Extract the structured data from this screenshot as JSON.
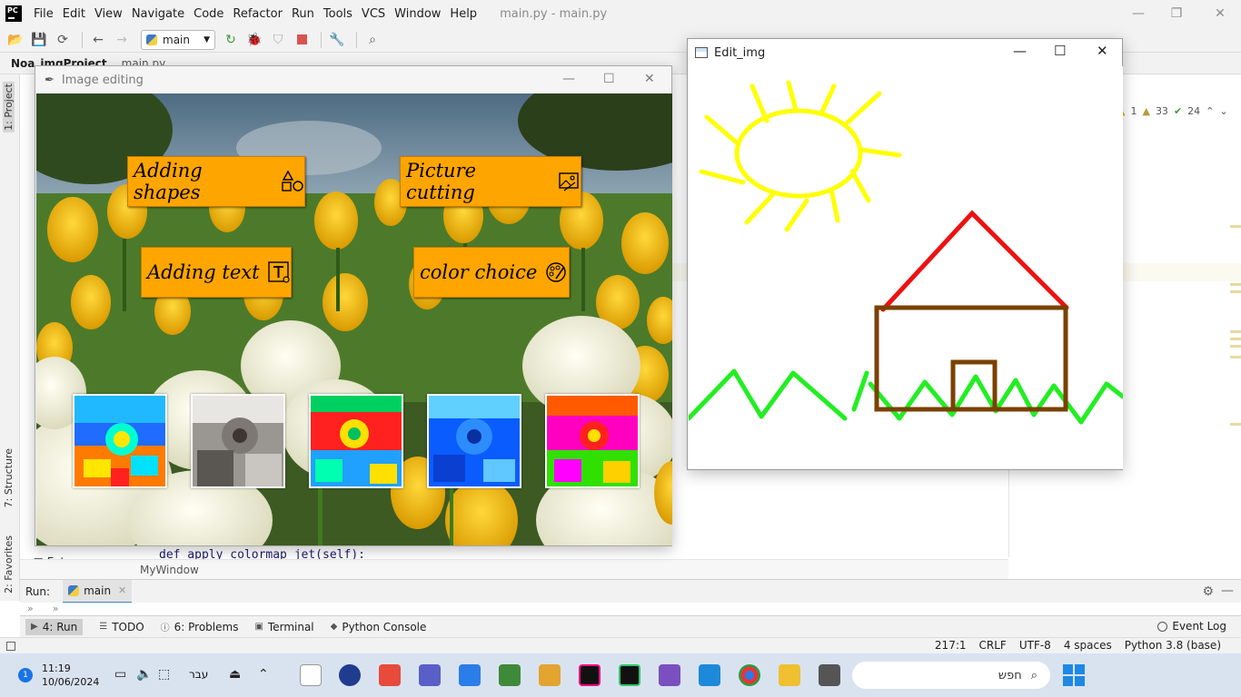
{
  "ide": {
    "menu": [
      "File",
      "Edit",
      "View",
      "Navigate",
      "Code",
      "Refactor",
      "Run",
      "Tools",
      "VCS",
      "Window",
      "Help"
    ],
    "title": "main.py - main.py",
    "run_config": "main",
    "project_crumb": "Noa_imgProject",
    "file_crumb": "main.py",
    "inspections": {
      "warnings_a": "1",
      "warnings_b": "33",
      "ok": "24"
    },
    "code_peek_line": "def apply_colormap_jet(self):",
    "tree_item": "Ext",
    "structure_crumb": "MyWindow",
    "side_tabs": {
      "project": "1: Project",
      "structure": "7: Structure",
      "favorites": "2: Favorites"
    }
  },
  "run_panel": {
    "label": "Run:",
    "tab": "main"
  },
  "tool_tabs": {
    "run": "4: Run",
    "todo": "TODO",
    "problems": "6: Problems",
    "terminal": "Terminal",
    "python_console": "Python Console",
    "event_log": "Event Log"
  },
  "status": {
    "position": "217:1",
    "line_sep": "CRLF",
    "encoding": "UTF-8",
    "indent": "4 spaces",
    "interpreter": "Python 3.8 (base)"
  },
  "image_editing": {
    "title": "Image editing",
    "buttons": {
      "adding_shapes": "Adding shapes",
      "picture_cutting": "Picture cutting",
      "adding_text": "Adding text",
      "color_choice": "color choice"
    },
    "button_color": "#ffa500"
  },
  "edit_img": {
    "title": "Edit_img",
    "colors": {
      "sun": "#ffff00",
      "roof": "#ee1111",
      "house": "#7b4100",
      "grass": "#22ee22"
    }
  },
  "taskbar": {
    "time": "11:19",
    "date": "10/06/2024",
    "lang": "עבר",
    "search_placeholder": "חפש",
    "notification_count": "1"
  }
}
